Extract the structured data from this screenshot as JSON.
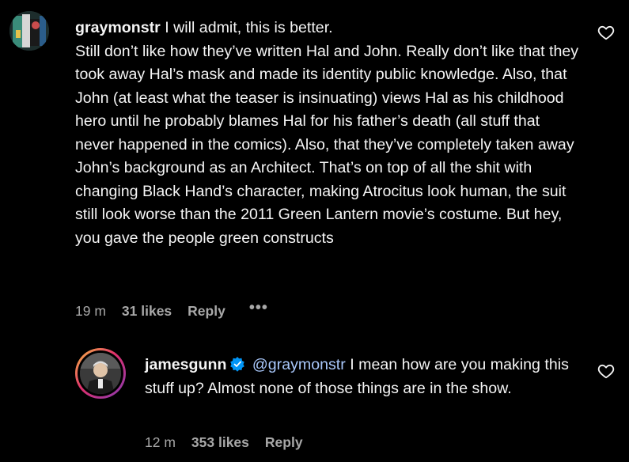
{
  "comments": [
    {
      "username": "graymonstr",
      "text_first": "I will admit, this is better.",
      "text_rest": "Still don’t like how they’ve written Hal and John. Really don’t like that they took away Hal’s mask and made its identity public knowledge. Also, that John (at least what the teaser is insinuating) views Hal as his childhood hero until he probably blames Hal for his father’s death (all stuff that never happened in the comics). Also, that they’ve completely taken away John’s background as an Architect. That’s on top of all the shit with changing Black Hand’s character, making Atrocitus look human, the suit still look worse than the 2011 Green Lantern movie’s costume. But hey, you gave the people green constructs",
      "time": "19 m",
      "likes": "31 likes",
      "reply_label": "Reply",
      "more_label": "•••",
      "avatar_icon": "user-avatar-graymonstr",
      "like_icon": "heart-outline-icon"
    },
    {
      "username": "jamesgunn",
      "verified": true,
      "mention": "@graymonstr",
      "text": "I mean how are you making this stuff up? Almost none of those things are in the show.",
      "time": "12 m",
      "likes": "353 likes",
      "reply_label": "Reply",
      "avatar_icon": "user-avatar-jamesgunn",
      "like_icon": "heart-outline-icon"
    }
  ],
  "colors": {
    "background": "#000000",
    "text": "#f5f5f5",
    "meta": "#a8a8a8",
    "mention": "#a8c7fa",
    "verified": "#0095f6"
  }
}
